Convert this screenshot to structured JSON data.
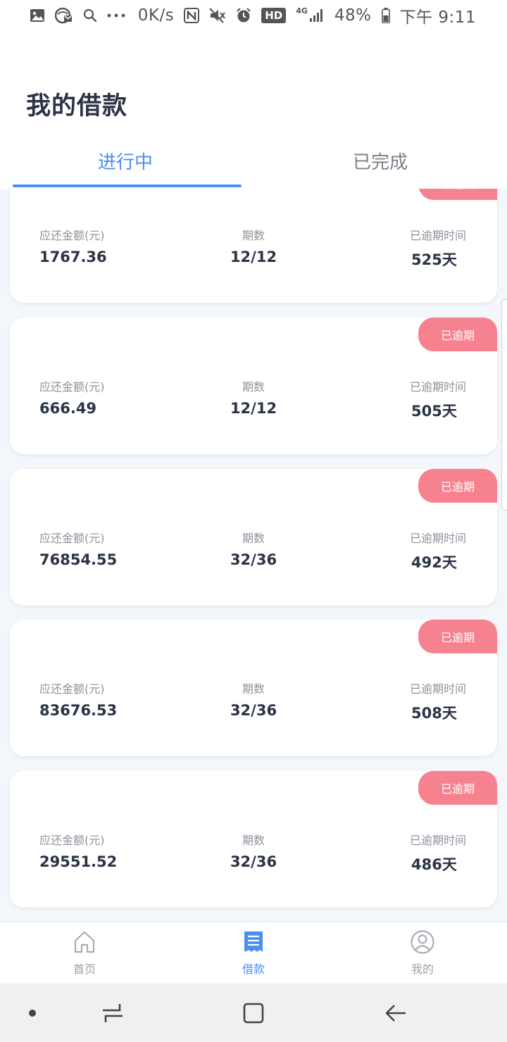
{
  "status_bar": {
    "net_speed": "0K/s",
    "hd": "HD",
    "net_type": "4G",
    "battery": "48%",
    "time": "下午 9:11",
    "icons": [
      "gallery-icon",
      "vpn-icon",
      "search-icon",
      "more-icon",
      "nfc-icon",
      "mute-icon",
      "alarm-icon",
      "signal-icon",
      "battery-icon"
    ]
  },
  "header": {
    "title": "我的借款",
    "tabs": [
      {
        "label": "进行中",
        "active": true
      },
      {
        "label": "已完成",
        "active": false
      }
    ]
  },
  "loans": [
    {
      "amount_label": "应还金额(元)",
      "amount": "1767.36",
      "period_label": "期数",
      "period": "12/12",
      "overdue_label": "已逾期时间",
      "overdue": "525天",
      "badge": "已逾期"
    },
    {
      "amount_label": "应还金额(元)",
      "amount": "666.49",
      "period_label": "期数",
      "period": "12/12",
      "overdue_label": "已逾期时间",
      "overdue": "505天",
      "badge": "已逾期"
    },
    {
      "amount_label": "应还金额(元)",
      "amount": "76854.55",
      "period_label": "期数",
      "period": "32/36",
      "overdue_label": "已逾期时间",
      "overdue": "492天",
      "badge": "已逾期"
    },
    {
      "amount_label": "应还金额(元)",
      "amount": "83676.53",
      "period_label": "期数",
      "period": "32/36",
      "overdue_label": "已逾期时间",
      "overdue": "508天",
      "badge": "已逾期"
    },
    {
      "amount_label": "应还金额(元)",
      "amount": "29551.52",
      "period_label": "期数",
      "period": "32/36",
      "overdue_label": "已逾期时间",
      "overdue": "486天",
      "badge": "已逾期"
    }
  ],
  "bottom_nav": [
    {
      "label": "首页",
      "icon": "home-icon",
      "active": false
    },
    {
      "label": "借款",
      "icon": "bill-icon",
      "active": true
    },
    {
      "label": "我的",
      "icon": "profile-icon",
      "active": false
    }
  ],
  "colors": {
    "accent": "#4a8ff0",
    "overdue_badge": "#f7828f",
    "text_primary": "#2b3346",
    "text_secondary": "#8d929b",
    "background": "#f3f6fa"
  }
}
